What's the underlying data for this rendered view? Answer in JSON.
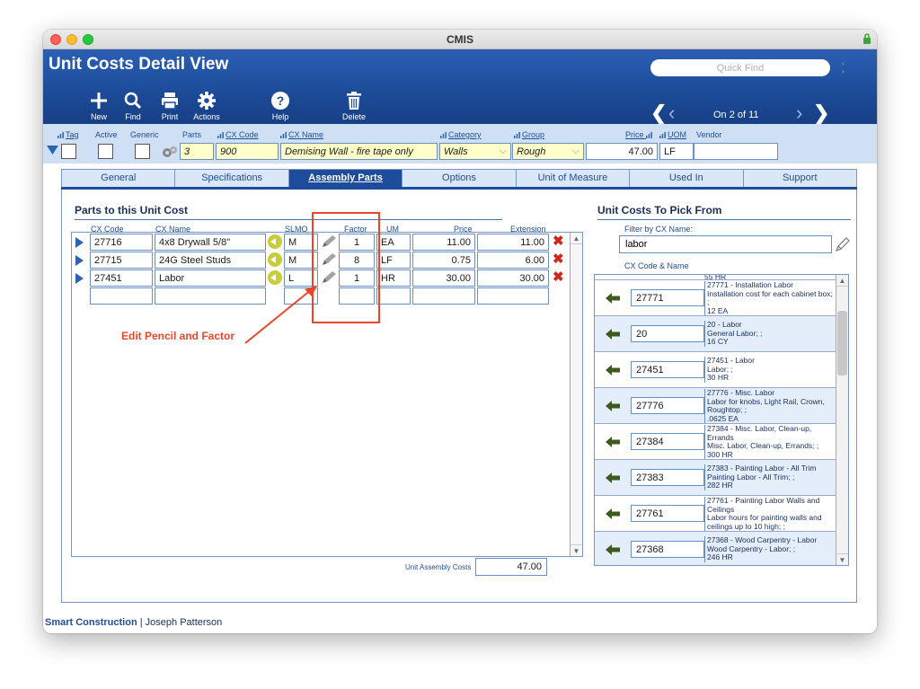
{
  "window": {
    "title": "CMIS"
  },
  "app": {
    "title": "Unit Costs Detail View"
  },
  "quick_find": {
    "placeholder": "Quick Find"
  },
  "toolbar": {
    "new": "New",
    "find": "Find",
    "print": "Print",
    "actions": "Actions",
    "help": "Help",
    "delete": "Delete"
  },
  "nav": {
    "record_status": "On 2 of 11"
  },
  "fields": {
    "labels": {
      "tag": "Tag",
      "active": "Active",
      "generic": "Generic",
      "parts": "Parts",
      "cx_code": "CX Code",
      "cx_name": "CX Name",
      "category": "Category",
      "group": "Group",
      "price": "Price",
      "uom": "UOM",
      "vendor": "Vendor"
    },
    "values": {
      "parts": "3",
      "cx_code": "900",
      "cx_name": "Demising Wall - fire tape only",
      "category": "Walls",
      "group": "Rough",
      "price": "47.00",
      "uom": "LF",
      "vendor": ""
    }
  },
  "tabs": [
    "General",
    "Specifications",
    "Assembly Parts",
    "Options",
    "Unit of Measure",
    "Used In",
    "Support"
  ],
  "active_tab": "Assembly Parts",
  "parts": {
    "title": "Parts to this Unit Cost",
    "columns": {
      "cx_code": "CX Code",
      "cx_name": "CX Name",
      "slmo": "SLMO",
      "factor": "Factor",
      "um": "UM",
      "price": "Price",
      "extension": "Extension"
    },
    "rows": [
      {
        "code": "27716",
        "name": "4x8 Drywall 5/8\"",
        "slmo": "M",
        "factor": "1",
        "um": "EA",
        "price": "11.00",
        "extension": "11.00"
      },
      {
        "code": "27715",
        "name": "24G Steel Studs",
        "slmo": "M",
        "factor": "8",
        "um": "LF",
        "price": "0.75",
        "extension": "6.00"
      },
      {
        "code": "27451",
        "name": "Labor",
        "slmo": "L",
        "factor": "1",
        "um": "HR",
        "price": "30.00",
        "extension": "30.00"
      }
    ],
    "annotation": "Edit Pencil and Factor",
    "total_label": "Unit Assembly Costs",
    "total_value": "47.00"
  },
  "picker": {
    "title": "Unit Costs To Pick From",
    "filter_label": "Filter by CX Name:",
    "filter_value": "labor",
    "list_header": "CX Code & Name",
    "top_partial": "55 HR",
    "items": [
      {
        "code": "27771",
        "desc": "27771 - Installation Labor\nInstallation cost for each cabinet box; ;\n12 EA"
      },
      {
        "code": "20",
        "desc": "20 - Labor\nGeneral Labor; ;\n16 CY"
      },
      {
        "code": "27451",
        "desc": "27451 - Labor\nLabor; ;\n30 HR"
      },
      {
        "code": "27776",
        "desc": "27776 - Misc. Labor\nLabor for knobs, Light Rail, Crown, Roughtop; ;\n.0625 EA"
      },
      {
        "code": "27384",
        "desc": "27384 - Misc. Labor, Clean-up, Errands\nMisc. Labor, Clean-up, Errands; ;\n300 HR"
      },
      {
        "code": "27383",
        "desc": "27383 - Painting Labor - All Trim\nPainting Labor - All Trim; ;\n282 HR"
      },
      {
        "code": "27761",
        "desc": "27761 - Painting Labor Walls and Ceilings\nLabor hours for painting walls and ceilings up to 10 high; ;"
      },
      {
        "code": "27368",
        "desc": "27368 - Wood Carpentry - Labor\nWood Carpentry - Labor; ;\n246 HR"
      }
    ]
  },
  "footer": {
    "brand": "Smart Construction",
    "user": "Joseph Patterson"
  },
  "colors": {
    "header": "#1d4c9a",
    "accent": "#2c63b5",
    "annotation": "#e9462a",
    "delete": "#d0271b",
    "pick_arrow": "#3d5a1e"
  }
}
